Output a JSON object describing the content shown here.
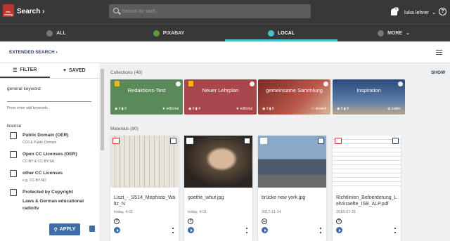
{
  "app": {
    "logo_text": "edu-sharing",
    "title": "Search",
    "search_placeholder": "Search for stuff...",
    "notification_count": "0",
    "user_name": "luka lehrer",
    "help": "?"
  },
  "tabs": [
    {
      "label": "ALL"
    },
    {
      "label": "PIXABAY"
    },
    {
      "label": "LOCAL"
    },
    {
      "label": "MORE"
    }
  ],
  "subbar": {
    "extended_search": "EXTENDED SEARCH"
  },
  "sidebar": {
    "filter_label": "FILTER",
    "saved_label": "SAVED",
    "keyword_label": "general keyword",
    "keyword_hint": "Press enter add keywords.",
    "license_label": "license",
    "licenses": [
      {
        "label": "Public Domain (OER)",
        "sub": "CC0 & Public Domain"
      },
      {
        "label": "Open CC Licenses (OER)",
        "sub": "CC-BY & CC-BY-SA"
      },
      {
        "label": "other CC Licenses",
        "sub": "e.g. CC-BY-ND"
      },
      {
        "label": "Protected by Copyright",
        "sub": "Laws & German educational radio/tv"
      }
    ],
    "apply_label": "APPLY"
  },
  "collections": {
    "header": "Collections (48)",
    "show_label": "SHOW",
    "items": [
      {
        "name": "Redaktions-Test",
        "count1": "0",
        "count2": "0",
        "owner": "editorial",
        "color": "#5b8a5a"
      },
      {
        "name": "Neuer Lehrplan",
        "count1": "0",
        "count2": "4",
        "owner": "editorial",
        "color": "#a8474b"
      },
      {
        "name": "gemeinsame Sammlung",
        "count1": "0",
        "count2": "0",
        "owner": "shared",
        "color": "#8a3a2c"
      },
      {
        "name": "Inspiration",
        "count1": "0",
        "count2": "8",
        "owner": "public",
        "color": "#3b5a8a"
      }
    ]
  },
  "materials": {
    "header": "Materials (80)",
    "items": [
      {
        "name": "Liszt_-_S514_Mephisto_Waltz_N",
        "date": "today, 4:02",
        "license": "?"
      },
      {
        "name": "goethe_whut.jpg",
        "date": "today, 4:01",
        "license": "?"
      },
      {
        "name": "brücke new york.jpg",
        "date": "2017-11-14",
        "license": "cc"
      },
      {
        "name": "Richtlinien_Befoerderung_Lehrkraefte_ISB_ALP.pdf",
        "date": "2018-07-31",
        "license": "?"
      }
    ]
  }
}
